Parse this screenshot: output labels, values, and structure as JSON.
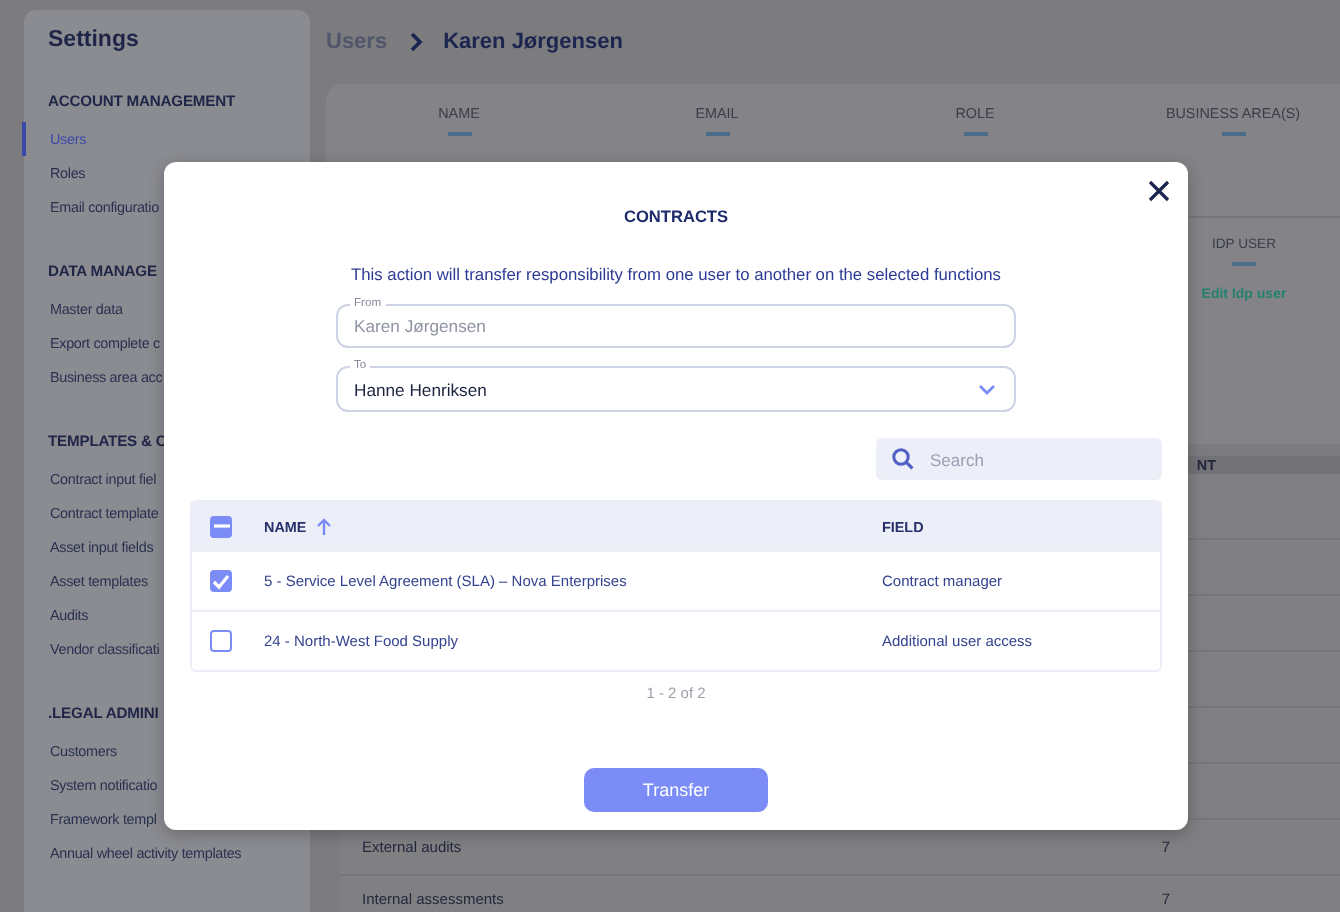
{
  "sidebar": {
    "title": "Settings",
    "sections": [
      {
        "heading": "ACCOUNT MANAGEMENT",
        "items": [
          {
            "label": "Users",
            "selected": true
          },
          {
            "label": "Roles",
            "selected": false
          },
          {
            "label": "Email configuratio",
            "selected": false
          }
        ]
      },
      {
        "heading": "DATA MANAGE",
        "items": [
          {
            "label": "Master data",
            "selected": false
          },
          {
            "label": "Export complete c",
            "selected": false
          },
          {
            "label": "Business area acc",
            "selected": false
          }
        ]
      },
      {
        "heading": "TEMPLATES & C",
        "items": [
          {
            "label": "Contract input fiel",
            "selected": false
          },
          {
            "label": "Contract template",
            "selected": false
          },
          {
            "label": "Asset input fields",
            "selected": false
          },
          {
            "label": "Asset templates",
            "selected": false
          },
          {
            "label": "Audits",
            "selected": false
          },
          {
            "label": "Vendor classificati",
            "selected": false
          }
        ]
      },
      {
        "heading": ".LEGAL ADMINI",
        "items": [
          {
            "label": "Customers",
            "selected": false
          },
          {
            "label": "System notificatio",
            "selected": false
          },
          {
            "label": "Framework templ",
            "selected": false
          },
          {
            "label": "Annual wheel activity templates",
            "selected": false
          }
        ]
      }
    ]
  },
  "breadcrumb": [
    {
      "label": "Users"
    },
    {
      "label": "Karen Jørgensen"
    }
  ],
  "user_table": {
    "columns": [
      "NAME",
      "EMAIL",
      "ROLE",
      "BUSINESS AREA(S)"
    ],
    "idp": {
      "header": "IDP USER",
      "link": "Edit Idp user"
    }
  },
  "lower_table": {
    "column_header": "NT",
    "rows": [
      {
        "name": "External audits",
        "count": "7"
      },
      {
        "name": "Internal assessments",
        "count": "7"
      }
    ]
  },
  "modal": {
    "title": "CONTRACTS",
    "description": "This action will transfer responsibility from one user to another on the selected functions",
    "from": {
      "label": "From",
      "value": "Karen Jørgensen"
    },
    "to": {
      "label": "To",
      "value": "Hanne Henriksen"
    },
    "search": {
      "placeholder": "Search"
    },
    "table": {
      "some_selected": true,
      "columns": [
        {
          "label": "NAME",
          "sorted": true
        },
        {
          "label": "FIELD",
          "sorted": false
        }
      ],
      "rows": [
        {
          "name": "5 - Service Level Agreement (SLA) – Nova Enterprises",
          "field": "Contract manager",
          "checked": true
        },
        {
          "name": "24 - North-West Food Supply",
          "field": "Additional user access",
          "checked": false
        }
      ]
    },
    "pagination": "1 - 2 of 2",
    "button": "Transfer"
  }
}
